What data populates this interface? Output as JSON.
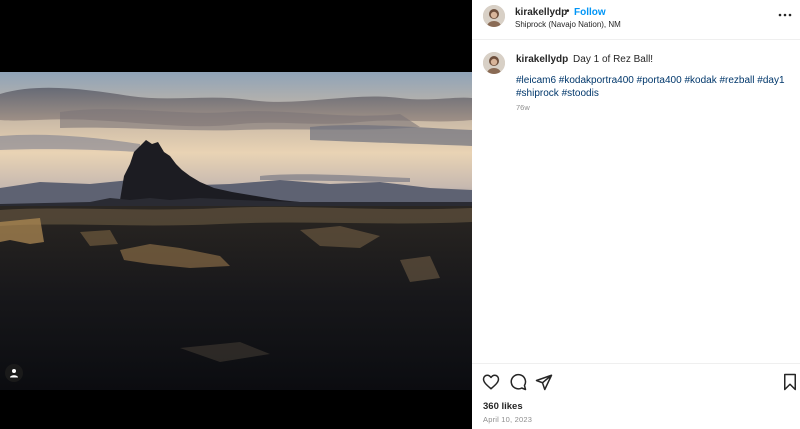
{
  "post": {
    "username": "kirakellydp",
    "separator": "•",
    "follow_label": "Follow",
    "location": "Shiprock (Navajo Nation), NM",
    "caption_text": "Day 1 of Rez Ball!",
    "hashtags": "#leicam6 #kodakportra400 #porta400 #kodak #rezball #day1 #shiprock #stoodis",
    "time_ago": "76w",
    "likes": "360 likes",
    "date": "April 10, 2023"
  },
  "icons": {
    "more": "more-options-icon",
    "like": "heart-icon",
    "comment": "comment-icon",
    "share": "send-icon",
    "save": "bookmark-icon",
    "tag": "user-tag-icon"
  },
  "colors": {
    "follow": "#0095f6",
    "hashtag": "#00376b",
    "muted": "#8e8e8e"
  }
}
